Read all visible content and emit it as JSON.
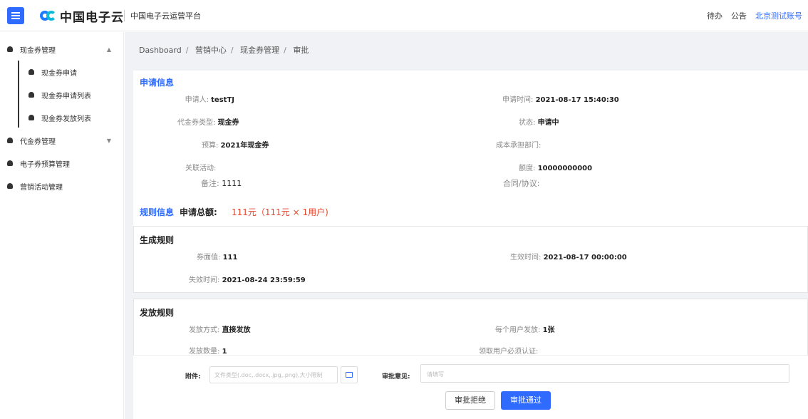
{
  "header": {
    "logo_text": "中国电子云",
    "platform": "中国电子云运营平台",
    "todo": "待办",
    "notice": "公告",
    "account": "北京测试账号"
  },
  "sidebar": {
    "items": [
      {
        "label": "现金券管理",
        "caret": "▲"
      },
      {
        "label": "现金券申请"
      },
      {
        "label": "现金券申请列表"
      },
      {
        "label": "现金券发放列表"
      },
      {
        "label": "代金券管理",
        "caret": "▼"
      },
      {
        "label": "电子券预算管理"
      },
      {
        "label": "营销活动管理"
      }
    ]
  },
  "breadcrumb": [
    "Dashboard",
    "营销中心",
    "现金券管理",
    "审批"
  ],
  "apply": {
    "title": "申请信息",
    "applicant_label": "申请人:",
    "applicant": "testTJ",
    "time_label": "申请时间:",
    "time": "2021-08-17 15:40:30",
    "type_label": "代金券类型:",
    "type": "现金券",
    "status_label": "状态:",
    "status": "申请中",
    "budget_label": "预算:",
    "budget": "2021年现金券",
    "dept_label": "成本承担部门:",
    "activity_label": "关联活动:",
    "amount_label": "额度:",
    "amount": "10000000000",
    "remark_label": "备注:",
    "remark": "1111",
    "contract_label": "合同/协议:"
  },
  "rules": {
    "title": "规则信息",
    "total_label": "申请总额:",
    "total": "111元（111元 × 1用户)",
    "gen": {
      "title": "生成规则",
      "face_label": "券面值:",
      "face": "111",
      "eff_label": "生效时间:",
      "eff": "2021-08-17 00:00:00",
      "exp_label": "失效时间:",
      "exp": "2021-08-24 23:59:59"
    },
    "dist": {
      "title": "发放规则",
      "method_label": "发放方式:",
      "method": "直接发放",
      "per_label": "每个用户发放:",
      "per": "1张",
      "count_label": "发放数量:",
      "count": "1",
      "verify_label": "领取用户必须认证:"
    }
  },
  "footer": {
    "attach_label": "附件:",
    "attach_placeholder": "文件类型(.doc,.docx,.jpg,.png),大小限制",
    "opinion_label": "审批意见:",
    "opinion_placeholder": "请填写",
    "reject": "审批拒绝",
    "approve": "审批通过"
  }
}
